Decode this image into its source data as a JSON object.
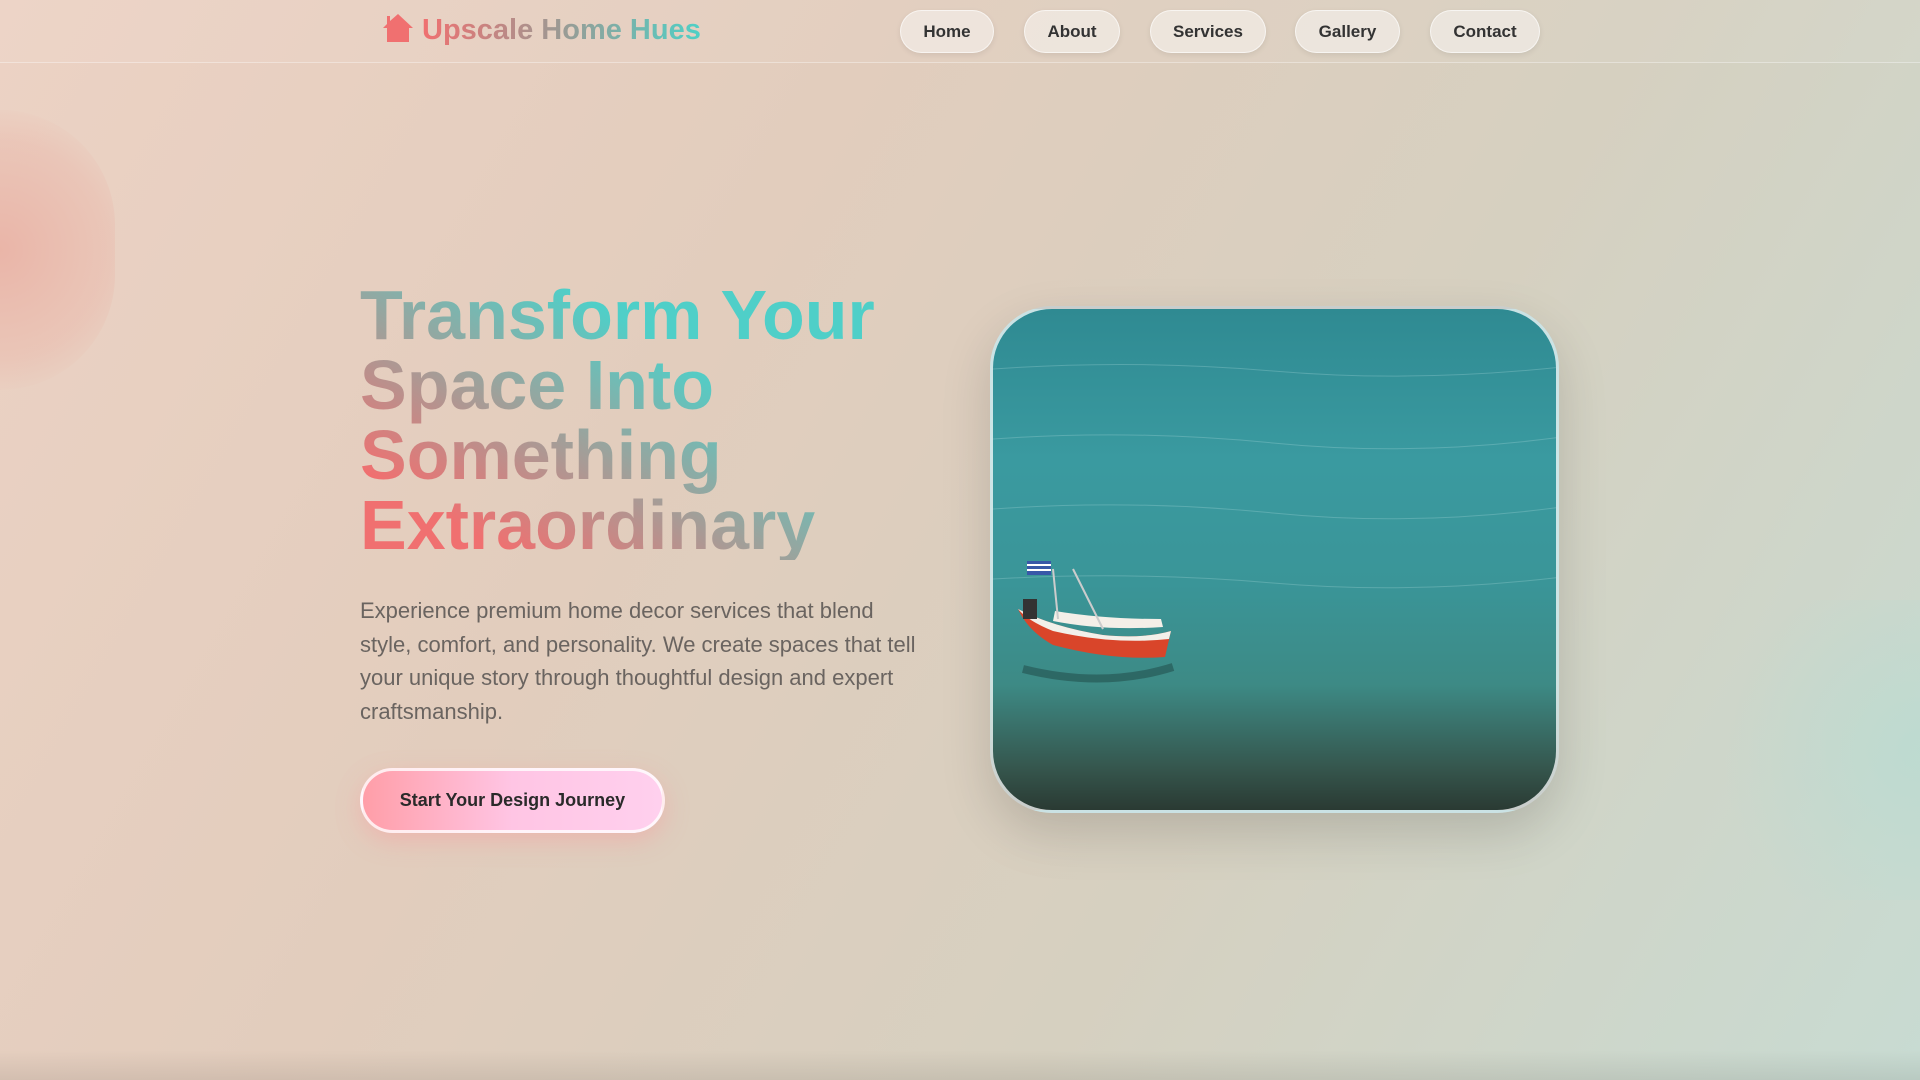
{
  "brand": {
    "name": "Upscale Home Hues",
    "icon": "house-icon"
  },
  "nav": {
    "items": [
      {
        "label": "Home"
      },
      {
        "label": "About"
      },
      {
        "label": "Services"
      },
      {
        "label": "Gallery"
      },
      {
        "label": "Contact"
      }
    ]
  },
  "hero": {
    "title": "Transform Your Space Into Something Extraordinary",
    "description": "Experience premium home decor services that blend style, comfort, and personality. We create spaces that tell your unique story through thoughtful design and expert craftsmanship.",
    "cta_label": "Start Your Design Journey"
  },
  "colors": {
    "accent_coral": "#f07070",
    "accent_teal": "#4fcfc8"
  }
}
